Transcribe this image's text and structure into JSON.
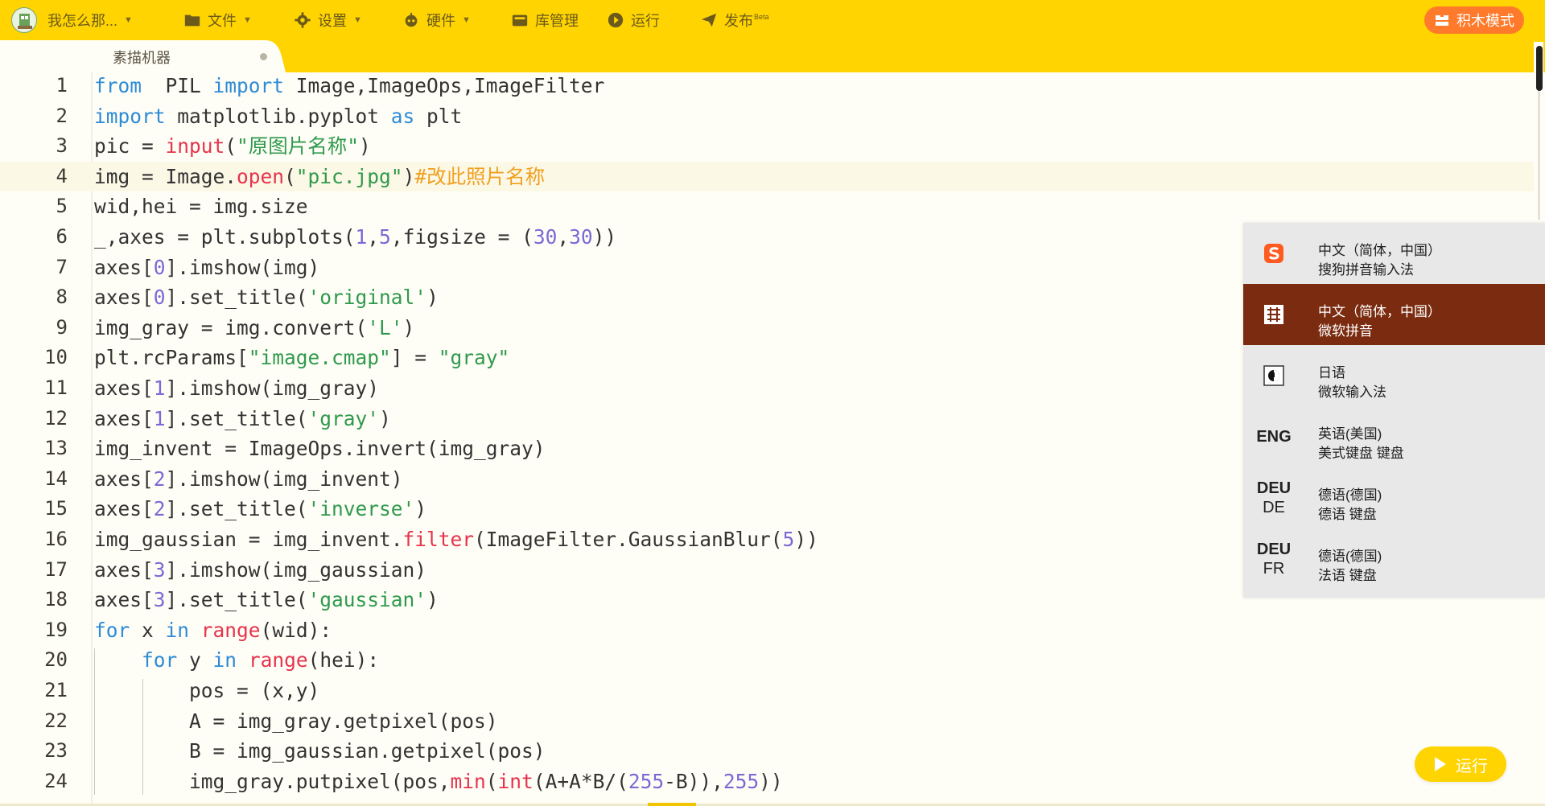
{
  "menu": {
    "user_label": "我怎么那...",
    "file": "文件",
    "settings": "设置",
    "hardware": "硬件",
    "library": "库管理",
    "run": "运行",
    "publish": "发布",
    "publish_badge": "Beta",
    "blocks_mode": "积木模式"
  },
  "editor": {
    "tab_name": "素描机器",
    "active_line": 4,
    "lines": [
      "1",
      "2",
      "3",
      "4",
      "5",
      "6",
      "7",
      "8",
      "9",
      "10",
      "11",
      "12",
      "13",
      "14",
      "15",
      "16",
      "17",
      "18",
      "19",
      "20",
      "21",
      "22",
      "23",
      "24"
    ],
    "code": [
      [
        [
          "kw",
          "from"
        ],
        [
          "",
          "  PIL "
        ],
        [
          "kw",
          "import"
        ],
        [
          "",
          " Image,ImageOps,ImageFilter"
        ]
      ],
      [
        [
          "kw",
          "import"
        ],
        [
          "",
          " matplotlib.pyplot "
        ],
        [
          "kw",
          "as"
        ],
        [
          "",
          " plt"
        ]
      ],
      [
        [
          "",
          "pic = "
        ],
        [
          "fn",
          "input"
        ],
        [
          "",
          "("
        ],
        [
          "str",
          "\"原图片名称\""
        ],
        [
          "",
          ")"
        ]
      ],
      [
        [
          "",
          "img = Image."
        ],
        [
          "fn",
          "open"
        ],
        [
          "",
          "("
        ],
        [
          "str",
          "\"pic.jpg\""
        ],
        [
          "",
          ")"
        ],
        [
          "cmt",
          "#改此照片名称"
        ]
      ],
      [
        [
          "",
          "wid,hei = img.size"
        ]
      ],
      [
        [
          "",
          "_,axes = plt.subplots("
        ],
        [
          "num",
          "1"
        ],
        [
          "",
          ","
        ],
        [
          "num",
          "5"
        ],
        [
          "",
          ",figsize = ("
        ],
        [
          "num",
          "30"
        ],
        [
          "",
          ","
        ],
        [
          "num",
          "30"
        ],
        [
          "",
          "))"
        ]
      ],
      [
        [
          "",
          "axes["
        ],
        [
          "num",
          "0"
        ],
        [
          "",
          "].imshow(img)"
        ]
      ],
      [
        [
          "",
          "axes["
        ],
        [
          "num",
          "0"
        ],
        [
          "",
          "].set_title("
        ],
        [
          "str",
          "'original'"
        ],
        [
          "",
          ")"
        ]
      ],
      [
        [
          "",
          "img_gray = img.convert("
        ],
        [
          "str",
          "'L'"
        ],
        [
          "",
          ")"
        ]
      ],
      [
        [
          "",
          "plt.rcParams["
        ],
        [
          "str",
          "\"image.cmap\""
        ],
        [
          "",
          "] = "
        ],
        [
          "str",
          "\"gray\""
        ]
      ],
      [
        [
          "",
          "axes["
        ],
        [
          "num",
          "1"
        ],
        [
          "",
          "].imshow(img_gray)"
        ]
      ],
      [
        [
          "",
          "axes["
        ],
        [
          "num",
          "1"
        ],
        [
          "",
          "].set_title("
        ],
        [
          "str",
          "'gray'"
        ],
        [
          "",
          ")"
        ]
      ],
      [
        [
          "",
          "img_invent = ImageOps.invert(img_gray)"
        ]
      ],
      [
        [
          "",
          "axes["
        ],
        [
          "num",
          "2"
        ],
        [
          "",
          "].imshow(img_invent)"
        ]
      ],
      [
        [
          "",
          "axes["
        ],
        [
          "num",
          "2"
        ],
        [
          "",
          "].set_title("
        ],
        [
          "str",
          "'inverse'"
        ],
        [
          "",
          ")"
        ]
      ],
      [
        [
          "",
          "img_gaussian = img_invent."
        ],
        [
          "fn",
          "filter"
        ],
        [
          "",
          "(ImageFilter.GaussianBlur("
        ],
        [
          "num",
          "5"
        ],
        [
          "",
          "))"
        ]
      ],
      [
        [
          "",
          "axes["
        ],
        [
          "num",
          "3"
        ],
        [
          "",
          "].imshow(img_gaussian)"
        ]
      ],
      [
        [
          "",
          "axes["
        ],
        [
          "num",
          "3"
        ],
        [
          "",
          "].set_title("
        ],
        [
          "str",
          "'gaussian'"
        ],
        [
          "",
          ")"
        ]
      ],
      [
        [
          "kw",
          "for"
        ],
        [
          "",
          " x "
        ],
        [
          "kw",
          "in"
        ],
        [
          "",
          ""
        ],
        [
          "fn",
          " range"
        ],
        [
          "",
          "(wid):"
        ]
      ],
      [
        [
          "",
          "    "
        ],
        [
          "kw",
          "for"
        ],
        [
          "",
          " y "
        ],
        [
          "kw",
          "in"
        ],
        [
          "fn",
          " range"
        ],
        [
          "",
          "(hei):"
        ]
      ],
      [
        [
          "",
          "        pos = (x,y)"
        ]
      ],
      [
        [
          "",
          "        A = img_gray.getpixel(pos)"
        ]
      ],
      [
        [
          "",
          "        B = img_gaussian.getpixel(pos)"
        ]
      ],
      [
        [
          "",
          "        img_gray.putpixel(pos,"
        ],
        [
          "fn",
          "min"
        ],
        [
          "",
          "("
        ],
        [
          "fn",
          "int"
        ],
        [
          "",
          "(A+A*B/("
        ],
        [
          "num",
          "255"
        ],
        [
          "",
          "-B)),"
        ],
        [
          "num",
          "255"
        ],
        [
          "",
          "))"
        ]
      ]
    ]
  },
  "ime": {
    "items": [
      {
        "icon": "sogou-icon",
        "line1": "中文（简体，中国）",
        "line2": "搜狗拼音输入法",
        "selected": false
      },
      {
        "icon": "pinyin-icon",
        "line1": "中文（简体，中国）",
        "line2": "微软拼音",
        "selected": true
      },
      {
        "icon": "japanese-ime-icon",
        "line1": "日语",
        "line2": "微软输入法",
        "selected": false
      },
      {
        "icon_text": "ENG",
        "icon_sub": "",
        "line1": "英语(美国)",
        "line2": "美式键盘 键盘",
        "selected": false
      },
      {
        "icon_text": "DEU",
        "icon_sub": "DE",
        "line1": "德语(德国)",
        "line2": "德语 键盘",
        "selected": false
      },
      {
        "icon_text": "DEU",
        "icon_sub": "FR",
        "line1": "德语(德国)",
        "line2": "法语 键盘",
        "selected": false
      }
    ]
  },
  "run_button": "运行",
  "colors": {
    "toolbar": "#ffd400",
    "blocks_button": "#ff7a2a",
    "ime_selected": "#7b2c10",
    "keyword": "#2e8bd6",
    "builtin": "#e6334d",
    "string": "#2f9a4d",
    "number": "#7a6ad6",
    "comment": "#f0a020"
  }
}
